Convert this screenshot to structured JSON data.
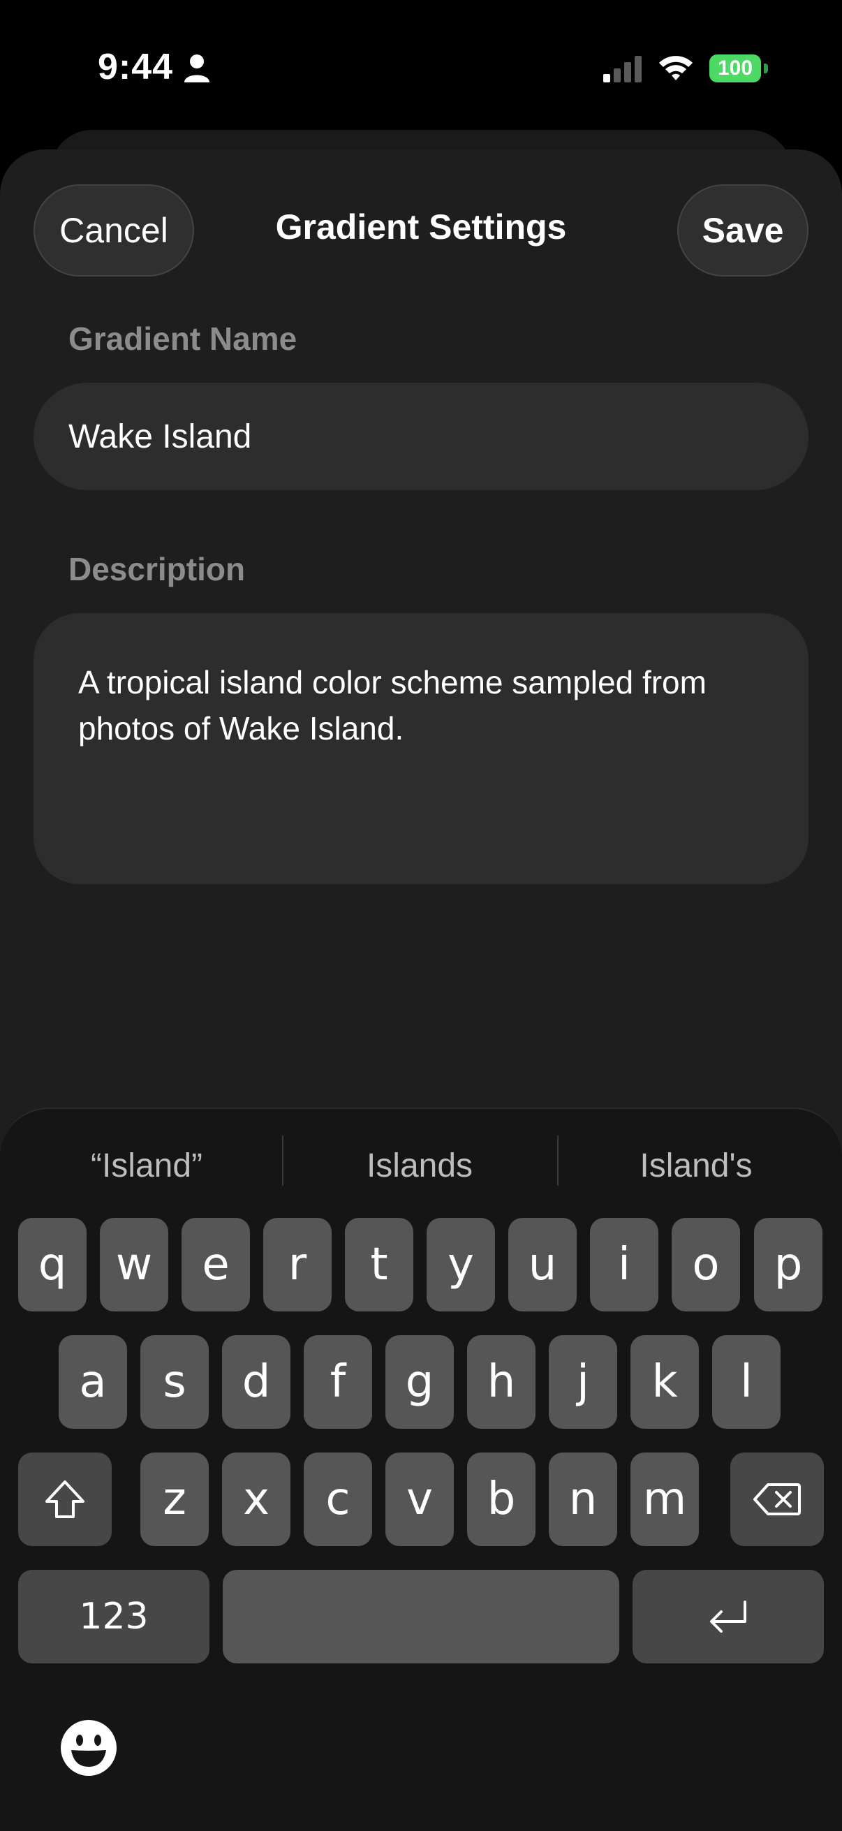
{
  "status": {
    "time": "9:44",
    "battery": "100"
  },
  "nav": {
    "cancel_label": "Cancel",
    "title": "Gradient Settings",
    "save_label": "Save"
  },
  "form": {
    "name_label": "Gradient Name",
    "name_value": "Wake Island",
    "description_label": "Description",
    "description_value": "A tropical island color scheme sampled from photos of Wake Island."
  },
  "keyboard": {
    "suggestions": [
      "“Island”",
      "Islands",
      "Island's"
    ],
    "row1": [
      "q",
      "w",
      "e",
      "r",
      "t",
      "y",
      "u",
      "i",
      "o",
      "p"
    ],
    "row2": [
      "a",
      "s",
      "d",
      "f",
      "g",
      "h",
      "j",
      "k",
      "l"
    ],
    "row3": [
      "z",
      "x",
      "c",
      "v",
      "b",
      "n",
      "m"
    ],
    "numbers_label": "123",
    "icons": {
      "shift": "shift-arrow-icon",
      "delete": "backspace-icon",
      "return": "return-arrow-icon",
      "emoji": "emoji-icon"
    }
  },
  "colors": {
    "battery": "#4cd964",
    "sheet": "#1e1e1e",
    "key": "#565656",
    "key_fn": "#474747",
    "field": "#2d2d2d"
  }
}
